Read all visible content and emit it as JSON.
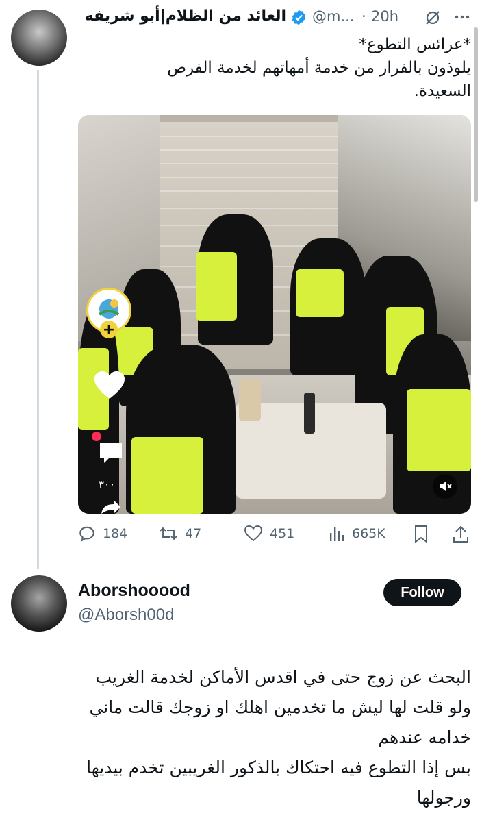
{
  "post": {
    "author_name": "العائد من الظلام|أبو شريفه",
    "handle": "@m...",
    "dot": "·",
    "time": "20h",
    "text_line1": "*عرائس التطوع*",
    "text_line2": "يلوذون بالفرار من خدمة أمهاتهم لخدمة الفرص",
    "text_line3": "السعيدة.",
    "media": {
      "overlay_count": "٣٠٠"
    },
    "actions": {
      "replies": "184",
      "reposts": "47",
      "likes": "451",
      "views": "665K"
    }
  },
  "reply": {
    "author_name": "Aborshooood",
    "handle": "@Aborsh00d",
    "follow_label": "Follow",
    "text_lines": [
      "البحث عن زوج حتى في اقدس الأماكن لخدمة الغريب",
      "ولو قلت لها ليش ما تخدمين اهلك او زوجك قالت ماني",
      "خدامه عندهم",
      "بس إذا التطوع فيه احتكاك بالذكور الغريبين تخدم بيديها",
      "ورجولها"
    ]
  },
  "colors": {
    "verified": "#1d9bf0",
    "muted": "#536471",
    "vest": "#d6f03c"
  }
}
